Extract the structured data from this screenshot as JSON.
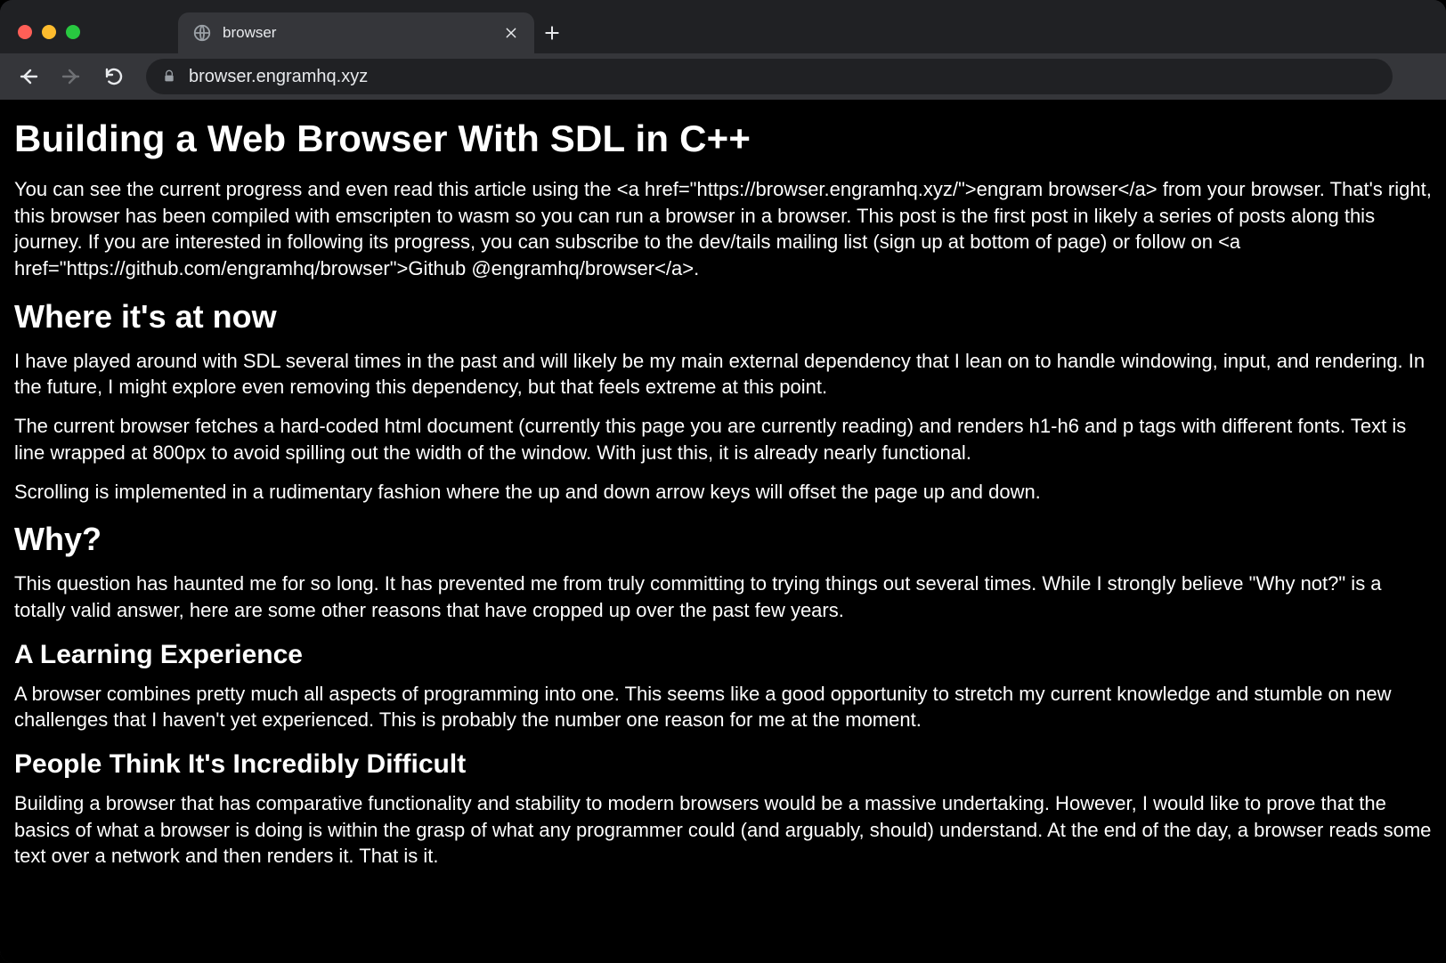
{
  "tab": {
    "title": "browser"
  },
  "toolbar": {
    "url": "browser.engramhq.xyz"
  },
  "page": {
    "h1": "Building a Web Browser With SDL in C++",
    "p1": "You can see the current progress and even read this article using the <a href=\"https://browser.engramhq.xyz/\">engram browser</a> from your browser.  That's right, this browser has been compiled with emscripten to wasm so you can run a browser in a browser.  This post is the first post in likely a series of posts along this journey.  If you are interested in following its progress, you can subscribe to the dev/tails mailing list (sign up at bottom of page) or follow on <a href=\"https://github.com/engramhq/browser\">Github @engramhq/browser</a>.",
    "h2a": "Where it's at now",
    "p2": "I have played around with SDL several times in the past and will likely be my main external dependency that I lean on to handle windowing, input, and rendering.  In the future, I might explore even removing this dependency, but that feels extreme at this point.",
    "p3": "The current browser fetches a hard-coded html document (currently this page you are currently reading) and renders h1-h6 and p tags with different fonts.  Text is line wrapped at 800px to avoid spilling out the width of the window.  With just this, it is already nearly functional.",
    "p4": "Scrolling is implemented in a rudimentary fashion where the up and down arrow keys will offset the page up and down.",
    "h2b": "Why?",
    "p5": "This question has haunted me for so long.  It has prevented me from truly committing to trying things out several times. While I strongly believe \"Why not?\" is a totally valid answer, here are some other reasons that have cropped up over the past few years.",
    "h3a": "A Learning Experience",
    "p6": "A browser combines pretty much all aspects of programming into one.  This seems like a good opportunity to stretch my current knowledge and stumble on new challenges that I haven't yet experienced. This is probably the number one reason for me at the moment.",
    "h3b": "People Think It's Incredibly Difficult",
    "p7": "Building a browser that has comparative functionality and stability to modern browsers would be a massive undertaking.  However, I would like to prove that the basics of what a browser is doing is within the grasp of what any programmer could (and arguably, should) understand.  At the end of the day, a browser reads some text over a network and then renders it.  That is it."
  }
}
